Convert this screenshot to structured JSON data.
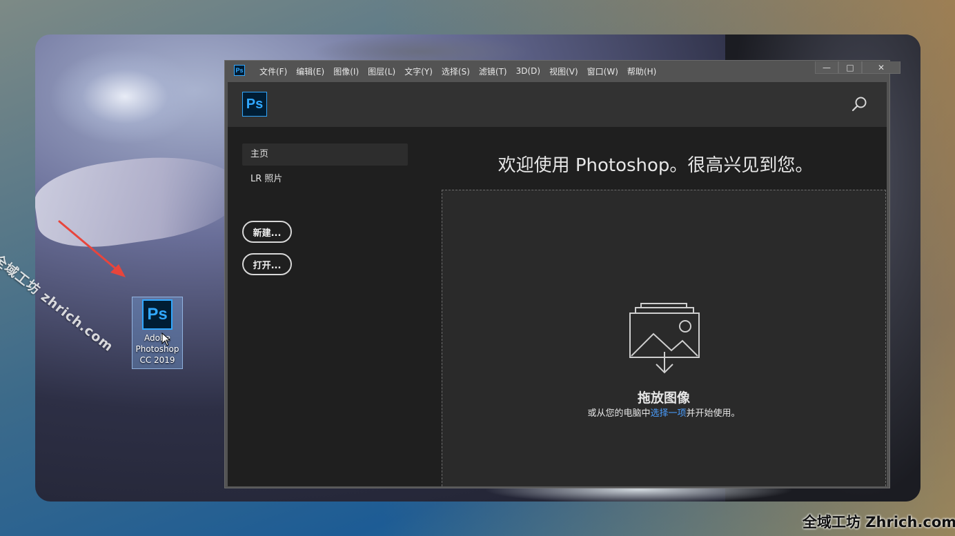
{
  "watermarks": {
    "diagonal": "全域工坊 zhrich.com",
    "corner": "全域工坊 Zhrich.com"
  },
  "desktop_icon": {
    "logo": "Ps",
    "label_line1": "Adobe",
    "label_line2": "Photoshop",
    "label_line3": "CC 2019"
  },
  "app": {
    "title_logo": "Ps",
    "menu": [
      "文件(F)",
      "编辑(E)",
      "图像(I)",
      "图层(L)",
      "文字(Y)",
      "选择(S)",
      "滤镜(T)",
      "3D(D)",
      "视图(V)",
      "窗口(W)",
      "帮助(H)"
    ],
    "window_controls": {
      "minimize": "—",
      "maximize": "□",
      "close": "✕"
    },
    "header_logo": "Ps",
    "search_icon": "search-icon"
  },
  "sidebar": {
    "items": [
      {
        "label": "主页",
        "active": true
      },
      {
        "label": "LR 照片",
        "active": false
      }
    ],
    "new_button": "新建...",
    "open_button": "打开..."
  },
  "main": {
    "welcome": "欢迎使用 Photoshop。很高兴见到您。",
    "drop_title": "拖放图像",
    "drop_sub_before": "或从您的电脑中",
    "drop_sub_link": "选择一项",
    "drop_sub_after": "并开始使用。"
  },
  "colors": {
    "ps_blue": "#31a8ff",
    "ps_dark": "#001d34",
    "link": "#4a9eff",
    "arrow": "#e8453c"
  }
}
